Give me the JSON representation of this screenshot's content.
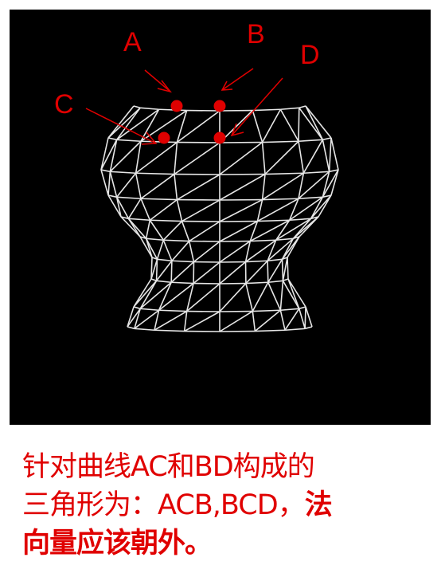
{
  "diagram": {
    "points": [
      {
        "label": "A"
      },
      {
        "label": "B"
      },
      {
        "label": "C"
      },
      {
        "label": "D"
      }
    ],
    "colors": {
      "background": "#000000",
      "mesh": "#e6e6e6",
      "annotation": "#e00000"
    }
  },
  "caption": {
    "line1": "针对曲线AC和BD构成的",
    "line2_normal": "三角形为：ACB,BCD，",
    "line2_bold": "法",
    "line3_bold": "向量应该朝外。"
  }
}
